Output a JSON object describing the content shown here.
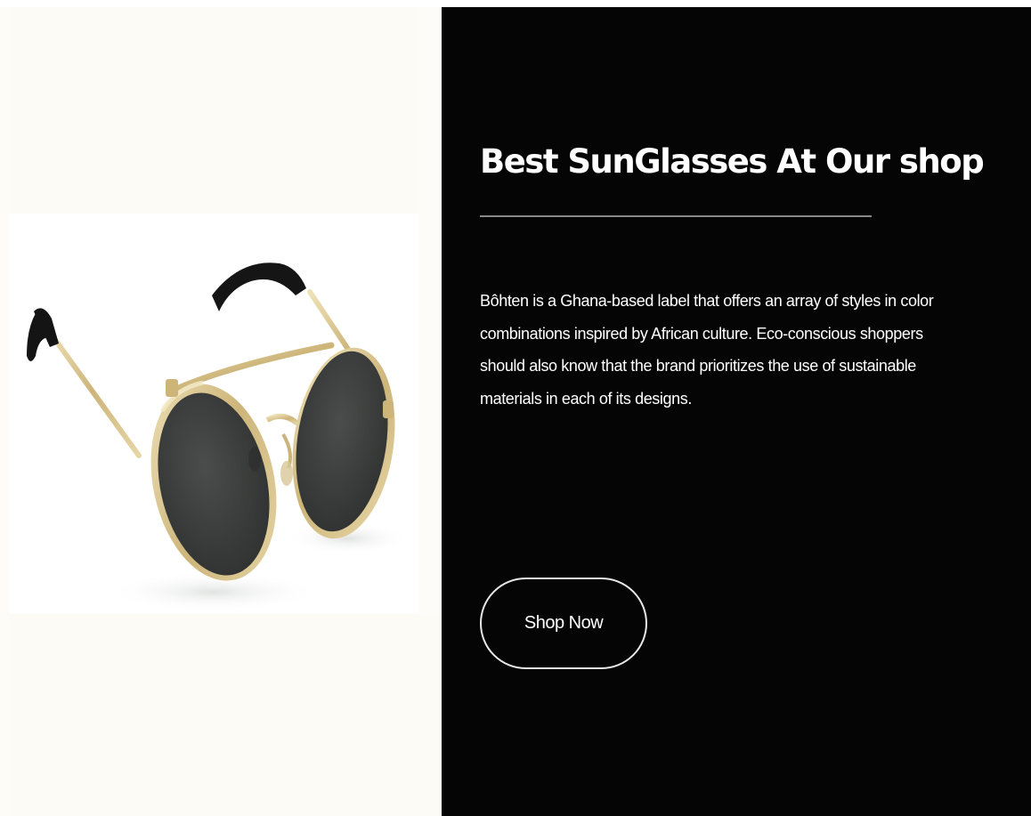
{
  "product_image": {
    "alt": "Round gold-frame sunglasses with dark lenses",
    "icon": "sunglasses-image"
  },
  "promo": {
    "title": "Best SunGlasses At Our shop",
    "description": "Bôhten is a Ghana-based label that offers an array of styles in color combinations inspired by African culture. Eco-conscious shoppers should also know that the brand prioritizes the use of sustainable materials in each of its designs.",
    "button_label": "Shop Now"
  },
  "colors": {
    "panel_background": "#050505",
    "image_background": "#fdfcf8",
    "text": "#ffffff",
    "divider": "#8a8a8a",
    "button_border": "#e8e8e8",
    "frame_gold": "#d6c38f",
    "lens": "#3f4240"
  }
}
